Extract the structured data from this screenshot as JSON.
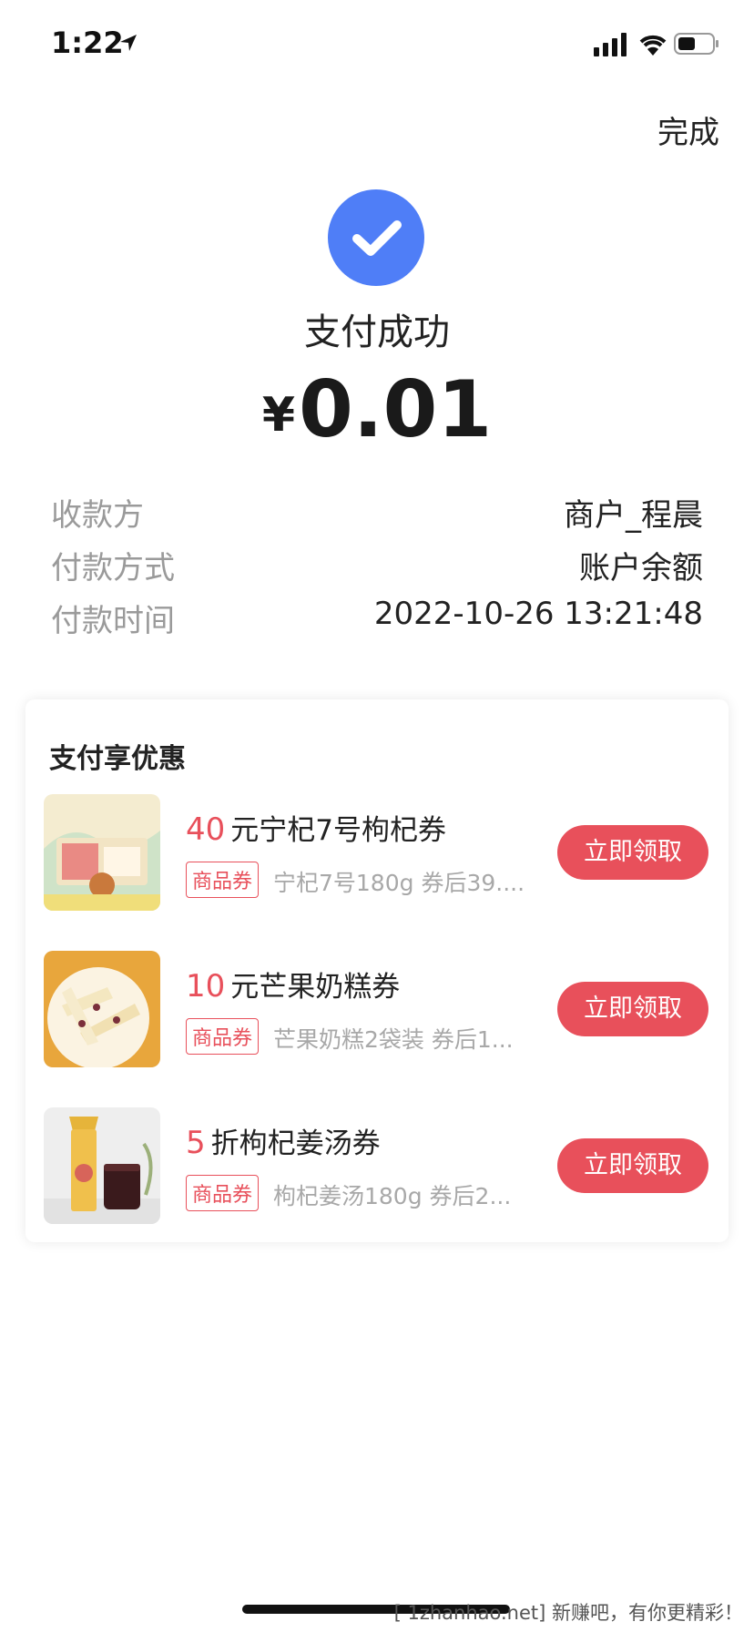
{
  "status_bar": {
    "time": "1:22"
  },
  "header": {
    "done_label": "完成"
  },
  "payment": {
    "title": "支付成功",
    "currency": "¥",
    "amount": "0.01"
  },
  "details": [
    {
      "label": "收款方",
      "value": "商户_程晨"
    },
    {
      "label": "付款方式",
      "value": "账户余额"
    },
    {
      "label": "付款时间",
      "value": "2022-10-26 13:21:48"
    }
  ],
  "promo": {
    "title": "支付享优惠",
    "coupons": [
      {
        "number": "40",
        "title": "元宁杞7号枸杞券",
        "tag": "商品券",
        "desc": "宁杞7号180g 券后39....",
        "button": "立即领取"
      },
      {
        "number": "10",
        "title": "元芒果奶糕券",
        "tag": "商品券",
        "desc": "芒果奶糕2袋装 券后1...",
        "button": "立即领取"
      },
      {
        "number": "5",
        "title": "折枸杞姜汤券",
        "tag": "商品券",
        "desc": "枸杞姜汤180g 券后2...",
        "button": "立即领取"
      }
    ]
  },
  "watermark": "[ 1zhanhao.net] 新赚吧，有你更精彩！",
  "colors": {
    "accent_blue": "#4f7ef7",
    "accent_red": "#e8505b"
  }
}
